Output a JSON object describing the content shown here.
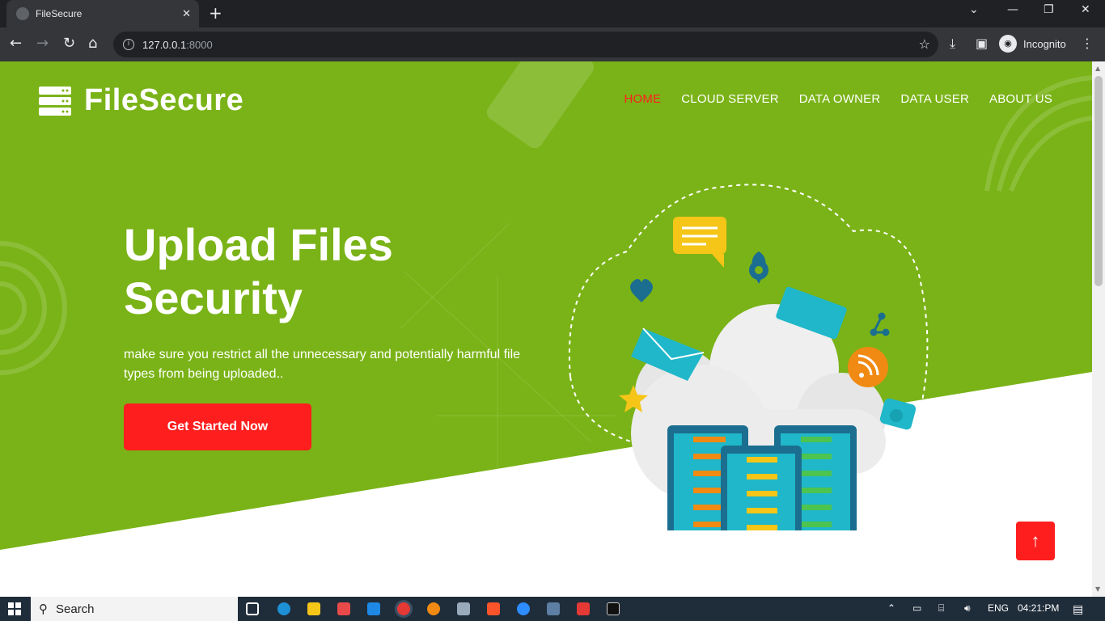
{
  "browser": {
    "tab_title": "FileSecure",
    "url_host": "127.0.0.1",
    "url_port": ":8000",
    "profile_label": "Incognito"
  },
  "site": {
    "brand": "FileSecure",
    "nav": [
      {
        "label": "HOME",
        "active": true
      },
      {
        "label": "CLOUD SERVER",
        "active": false
      },
      {
        "label": "DATA OWNER",
        "active": false
      },
      {
        "label": "DATA USER",
        "active": false
      },
      {
        "label": "ABOUT US",
        "active": false
      }
    ],
    "hero": {
      "title": "Upload Files Security",
      "subtitle": "make sure you restrict all the unnecessary and potentially harmful file types from being uploaded..",
      "cta_label": "Get Started Now"
    },
    "colors": {
      "hero_bg": "#7ab317",
      "accent": "#ff1e1e"
    }
  },
  "taskbar": {
    "search_label": "Search",
    "lang": "ENG",
    "time": "04:21:PM"
  }
}
